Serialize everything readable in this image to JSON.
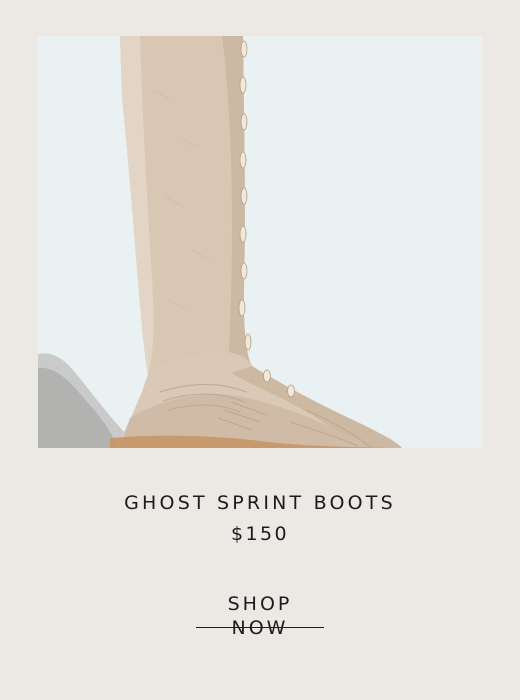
{
  "product": {
    "image_alt": "Tan suede knee-high lace-up boot",
    "name": "GHOST SPRINT BOOTS",
    "price": "$150"
  },
  "cta": {
    "label": "SHOP NOW"
  },
  "colors": {
    "page_bg": "#ece9e4",
    "image_bg": "#e9f1f2",
    "suede": "#d7c6b2",
    "text": "#1c1c1c"
  }
}
